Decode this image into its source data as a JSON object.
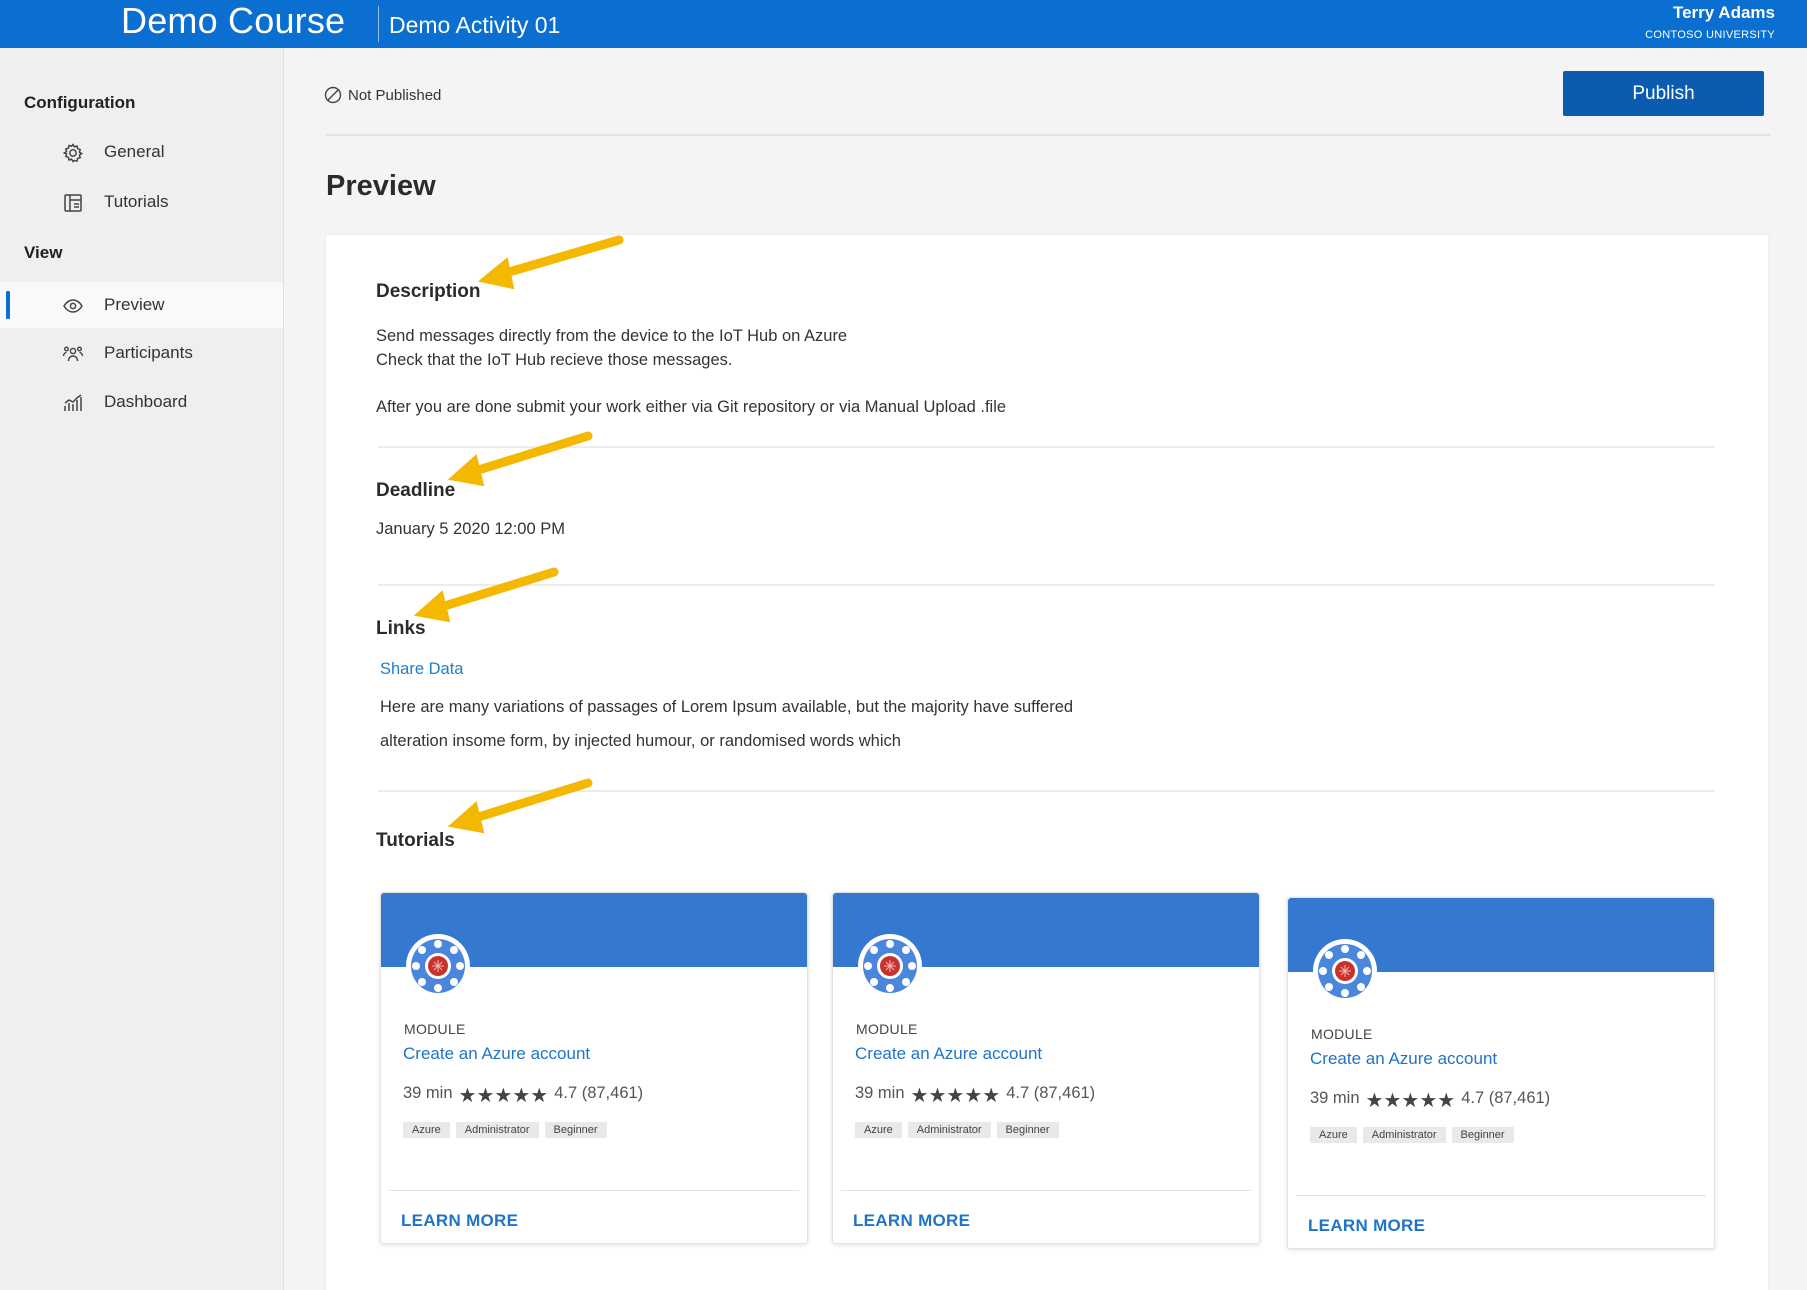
{
  "header": {
    "course": "Demo Course",
    "activity": "Demo Activity 01",
    "user_name": "Terry Adams",
    "user_org": "CONTOSO UNIVERSITY"
  },
  "sidebar": {
    "sections": [
      {
        "title": "Configuration",
        "items": [
          {
            "label": "General",
            "icon": "gear-icon"
          },
          {
            "label": "Tutorials",
            "icon": "tutorials-icon"
          }
        ]
      },
      {
        "title": "View",
        "items": [
          {
            "label": "Preview",
            "icon": "eye-icon",
            "active": true
          },
          {
            "label": "Participants",
            "icon": "participants-icon"
          },
          {
            "label": "Dashboard",
            "icon": "dashboard-icon"
          }
        ]
      }
    ]
  },
  "toolbar": {
    "status": "Not Published",
    "publish_label": "Publish"
  },
  "main": {
    "title": "Preview",
    "description": {
      "heading": "Description",
      "line1": "Send messages directly from the device to the IoT Hub on Azure",
      "line2": "Check that the IoT Hub recieve those messages.",
      "line3": "After you are done submit your work either via Git repository or via Manual Upload .file"
    },
    "deadline": {
      "heading": "Deadline",
      "value": "January 5 2020 12:00 PM"
    },
    "links": {
      "heading": "Links",
      "link_label": "Share Data",
      "text_line1": "Here are many variations of passages of Lorem Ipsum available, but the majority have suffered",
      "text_line2": "alteration insome form, by injected humour, or randomised words which"
    },
    "tutorials": {
      "heading": "Tutorials",
      "cards": [
        {
          "kind": "MODULE",
          "title": "Create an Azure account",
          "duration": "39 min",
          "stars": "★★★★★",
          "rating": "4.7 (87,461)",
          "tags": [
            "Azure",
            "Administrator",
            "Beginner"
          ],
          "cta": "LEARN MORE"
        },
        {
          "kind": "MODULE",
          "title": "Create an Azure account",
          "duration": "39 min",
          "stars": "★★★★★",
          "rating": "4.7 (87,461)",
          "tags": [
            "Azure",
            "Administrator",
            "Beginner"
          ],
          "cta": "LEARN MORE"
        },
        {
          "kind": "MODULE",
          "title": "Create an Azure account",
          "duration": "39 min",
          "stars": "★★★★★",
          "rating": "4.7 (87,461)",
          "tags": [
            "Azure",
            "Administrator",
            "Beginner"
          ],
          "cta": "LEARN MORE"
        }
      ]
    }
  },
  "colors": {
    "brand": "#0a6fd0",
    "publish": "#0b5cb0",
    "card_banner": "#3578d0",
    "link": "#1f7fd1",
    "annotation_arrow": "#f5b800"
  }
}
